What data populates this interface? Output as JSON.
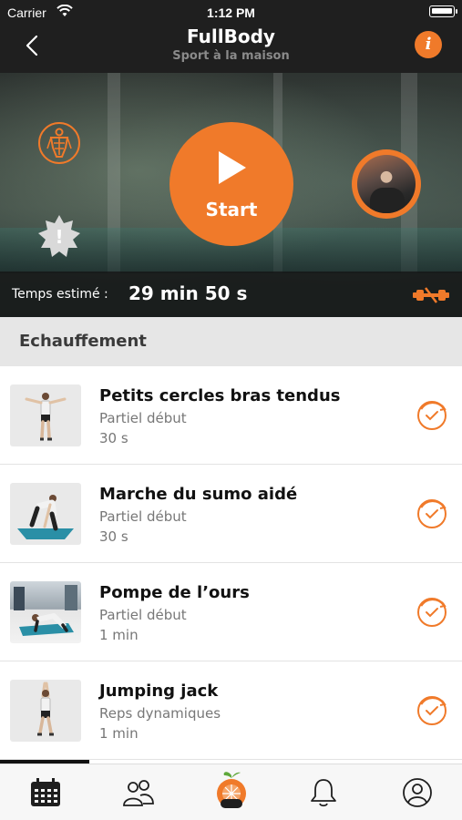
{
  "status_bar": {
    "carrier": "Carrier",
    "time": "1:12 PM",
    "battery_level": 1.0
  },
  "nav": {
    "title": "FullBody",
    "subtitle": "Sport à la maison",
    "back_icon": "chevron-left-icon",
    "info_icon": "info-icon",
    "info_glyph": "i"
  },
  "hero": {
    "start_label": "Start",
    "estimated_time_label": "Temps estimé :",
    "estimated_time_value": "29 min 50 s",
    "body_icon": "muscle-body-icon",
    "warning_icon": "warning-badge-icon",
    "warning_glyph": "!",
    "equipment_icon": "dumbbell-icon"
  },
  "section": {
    "title": "Echauffement"
  },
  "exercises": [
    {
      "name": "Petits cercles bras tendus",
      "type": "Partiel début",
      "duration": "30 s"
    },
    {
      "name": "Marche du sumo aidé",
      "type": "Partiel début",
      "duration": "30 s"
    },
    {
      "name": "Pompe de l’ours",
      "type": "Partiel début",
      "duration": "1 min"
    },
    {
      "name": "Jumping jack",
      "type": "Reps dynamiques",
      "duration": "1 min"
    }
  ],
  "tabbar": {
    "items": [
      {
        "icon": "calendar-icon"
      },
      {
        "icon": "community-icon"
      },
      {
        "icon": "app-logo-icon"
      },
      {
        "icon": "bell-icon"
      },
      {
        "icon": "profile-icon"
      }
    ]
  },
  "colors": {
    "accent": "#f07a2a",
    "header_bg": "#1f1f1f",
    "section_bg": "#e6e6e6"
  }
}
